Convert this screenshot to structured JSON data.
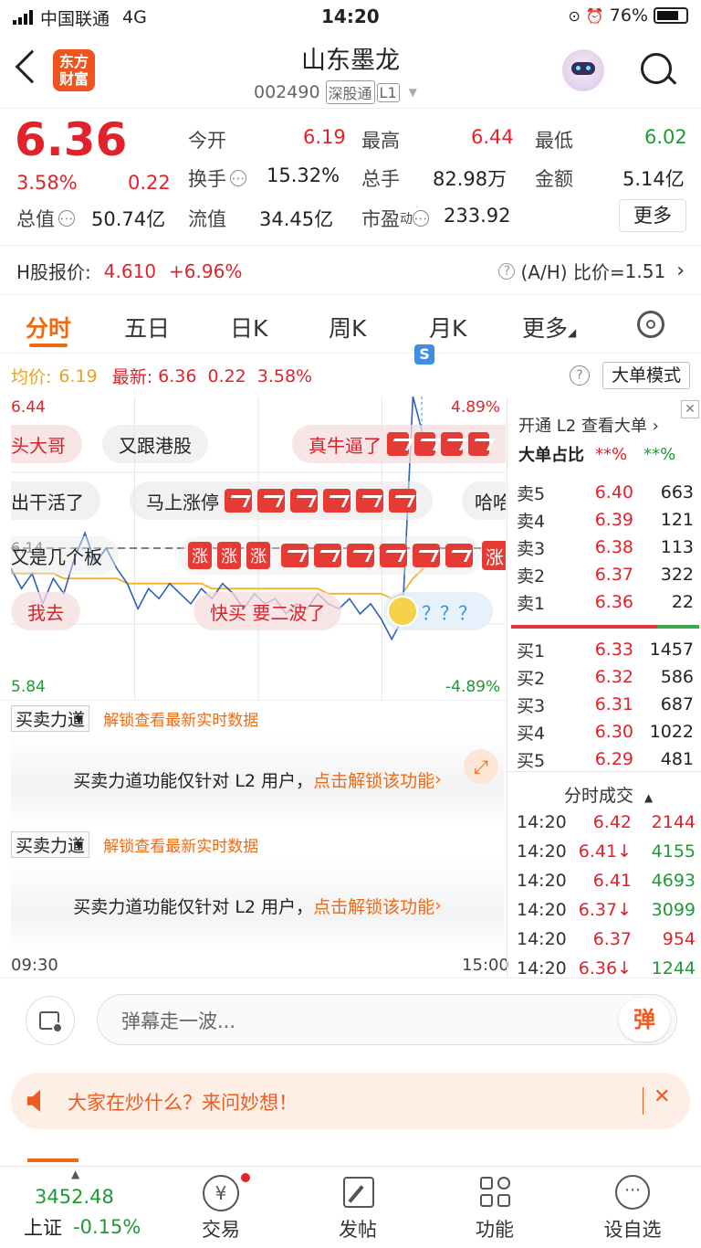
{
  "status": {
    "carrier": "中国联通",
    "network": "4G",
    "time": "14:20",
    "battery": "76%"
  },
  "header": {
    "logo_line1": "东方",
    "logo_line2": "财富",
    "name": "山东墨龙",
    "code": "002490",
    "exchange_tag": "深股通",
    "level": "L1"
  },
  "quote": {
    "price": "6.36",
    "pct": "3.58%",
    "chg": "0.22",
    "open_label": "今开",
    "open": "6.19",
    "high_label": "最高",
    "high": "6.44",
    "low_label": "最低",
    "low": "6.02",
    "turnover_label": "换手",
    "turnover": "15.32%",
    "volume_label": "总手",
    "volume": "82.98万",
    "amount_label": "金额",
    "amount": "5.14亿",
    "mcap_label": "总值",
    "mcap": "50.74亿",
    "float_label": "流值",
    "float": "34.45亿",
    "pe_label": "市盈",
    "pe_sup": "动",
    "pe": "233.92",
    "more": "更多"
  },
  "hshare": {
    "label": "H股报价:",
    "price": "4.610",
    "pct": "+6.96%",
    "ratio_label": "(A/H) 比价=",
    "ratio": "1.51"
  },
  "tabs": [
    "分时",
    "五日",
    "日K",
    "周K",
    "月K",
    "更多"
  ],
  "chart_info": {
    "avg_label": "均价:",
    "avg": "6.19",
    "last_label": "最新:",
    "last": "6.36",
    "chg": "0.22",
    "pct": "3.58%",
    "mode": "大单模式"
  },
  "chart_data": {
    "type": "line",
    "y_top": "6.44",
    "y_bottom": "5.84",
    "pct_top": "4.89%",
    "pct_bottom": "-4.89%",
    "pre_close": "6.14",
    "x_start": "09:30",
    "x_end": "15:00",
    "series": [
      {
        "values": [
          6.1,
          6.06,
          6.09,
          6.03,
          6.08,
          6.05,
          6.12,
          6.17,
          6.11,
          6.14,
          6.1,
          6.07,
          6.02,
          6.06,
          6.04,
          6.07,
          6.05,
          6.03,
          6.06,
          6.04,
          6.07,
          6.05,
          6.02,
          6.05,
          6.03,
          6.04,
          6.01,
          6.03,
          6.02,
          6.05,
          6.03,
          6.02,
          6.04,
          6.01,
          6.03,
          6.0,
          5.96,
          6.0,
          6.44,
          6.36
        ]
      },
      {
        "values": [
          6.09,
          6.09,
          6.09,
          6.09,
          6.09,
          6.08,
          6.08,
          6.08,
          6.08,
          6.08,
          6.08,
          6.07,
          6.07,
          6.07,
          6.07,
          6.07,
          6.07,
          6.07,
          6.07,
          6.06,
          6.06,
          6.06,
          6.06,
          6.06,
          6.06,
          6.06,
          6.06,
          6.06,
          6.06,
          6.06,
          6.05,
          6.05,
          6.05,
          6.05,
          6.05,
          6.05,
          6.04,
          6.05,
          6.08,
          6.1
        ]
      }
    ]
  },
  "danmaku": [
    "头大哥",
    "又跟港股",
    "真牛逼了",
    "出干活了",
    "马上涨停",
    "哈哈",
    "又是几个板",
    "我去",
    "快买 要二波了",
    "？？？"
  ],
  "zhang": "涨",
  "orderbook": {
    "promo": "开通 L2 查看大单",
    "big_label": "大单占比",
    "big_buy": "**%",
    "big_sell": "**%",
    "asks": [
      {
        "l": "卖5",
        "p": "6.40",
        "v": "663"
      },
      {
        "l": "卖4",
        "p": "6.39",
        "v": "121"
      },
      {
        "l": "卖3",
        "p": "6.38",
        "v": "113"
      },
      {
        "l": "卖2",
        "p": "6.37",
        "v": "322"
      },
      {
        "l": "卖1",
        "p": "6.36",
        "v": "22"
      }
    ],
    "bids": [
      {
        "l": "买1",
        "p": "6.33",
        "v": "1457"
      },
      {
        "l": "买2",
        "p": "6.32",
        "v": "586"
      },
      {
        "l": "买3",
        "p": "6.31",
        "v": "687"
      },
      {
        "l": "买4",
        "p": "6.30",
        "v": "1022"
      },
      {
        "l": "买5",
        "p": "6.29",
        "v": "481"
      }
    ]
  },
  "trades": {
    "title": "分时成交",
    "rows": [
      {
        "t": "14:20",
        "p": "6.42",
        "v": "2144"
      },
      {
        "t": "14:20",
        "p": "6.41↓",
        "v": "4155"
      },
      {
        "t": "14:20",
        "p": "6.41",
        "v": "4693"
      },
      {
        "t": "14:20",
        "p": "6.37↓",
        "v": "3099"
      },
      {
        "t": "14:20",
        "p": "6.37",
        "v": "954"
      },
      {
        "t": "14:20",
        "p": "6.36↓",
        "v": "1244"
      }
    ]
  },
  "indicator": {
    "name": "买卖力道",
    "unlock": "解锁查看最新实时数据",
    "msg": "买卖力道功能仅针对 L2 用户，",
    "cta": "点击解锁该功能"
  },
  "comment": {
    "placeholder": "弹幕走一波...",
    "send": "弹"
  },
  "banner": {
    "text": "大家在炒什么？来问妙想！"
  },
  "bottom": {
    "index_val": "3452.48",
    "index_name": "上证",
    "index_pct": "-0.15%",
    "items": [
      "交易",
      "发帖",
      "功能",
      "设自选"
    ]
  }
}
